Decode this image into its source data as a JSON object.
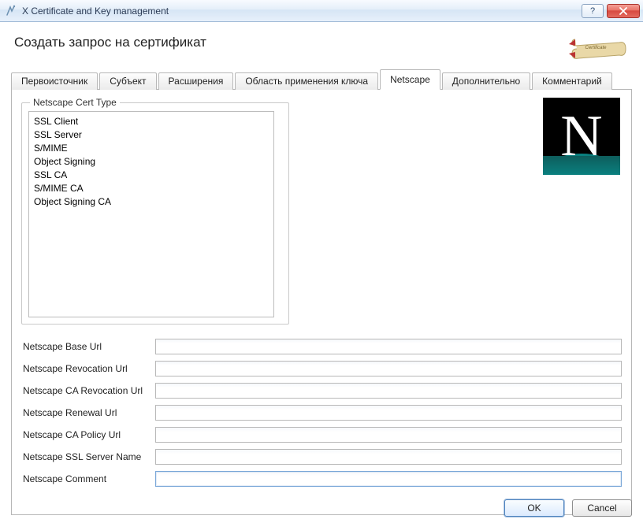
{
  "window": {
    "title": "X Certificate and Key management"
  },
  "page": {
    "heading": "Создать запрос на сертификат"
  },
  "tabs": [
    {
      "id": "src",
      "label": "Первоисточник"
    },
    {
      "id": "subject",
      "label": "Субъект"
    },
    {
      "id": "ext",
      "label": "Расширения"
    },
    {
      "id": "keyusage",
      "label": "Область применения ключа"
    },
    {
      "id": "netscape",
      "label": "Netscape"
    },
    {
      "id": "advanced",
      "label": "Дополнительно"
    },
    {
      "id": "comment",
      "label": "Комментарий"
    }
  ],
  "active_tab": "netscape",
  "group": {
    "title": "Netscape Cert Type",
    "items": [
      "SSL Client",
      "SSL Server",
      "S/MIME",
      "Object Signing",
      "SSL CA",
      "S/MIME CA",
      "Object Signing CA"
    ]
  },
  "fields": {
    "base_url": {
      "label": "Netscape Base Url",
      "value": ""
    },
    "revocation_url": {
      "label": "Netscape Revocation Url",
      "value": ""
    },
    "ca_revocation": {
      "label": "Netscape CA Revocation Url",
      "value": ""
    },
    "renewal_url": {
      "label": "Netscape Renewal Url",
      "value": ""
    },
    "ca_policy_url": {
      "label": "Netscape CA Policy Url",
      "value": ""
    },
    "ssl_server_name": {
      "label": "Netscape SSL Server Name",
      "value": ""
    },
    "comment": {
      "label": "Netscape Comment",
      "value": ""
    }
  },
  "buttons": {
    "ok": "OK",
    "cancel": "Cancel"
  }
}
